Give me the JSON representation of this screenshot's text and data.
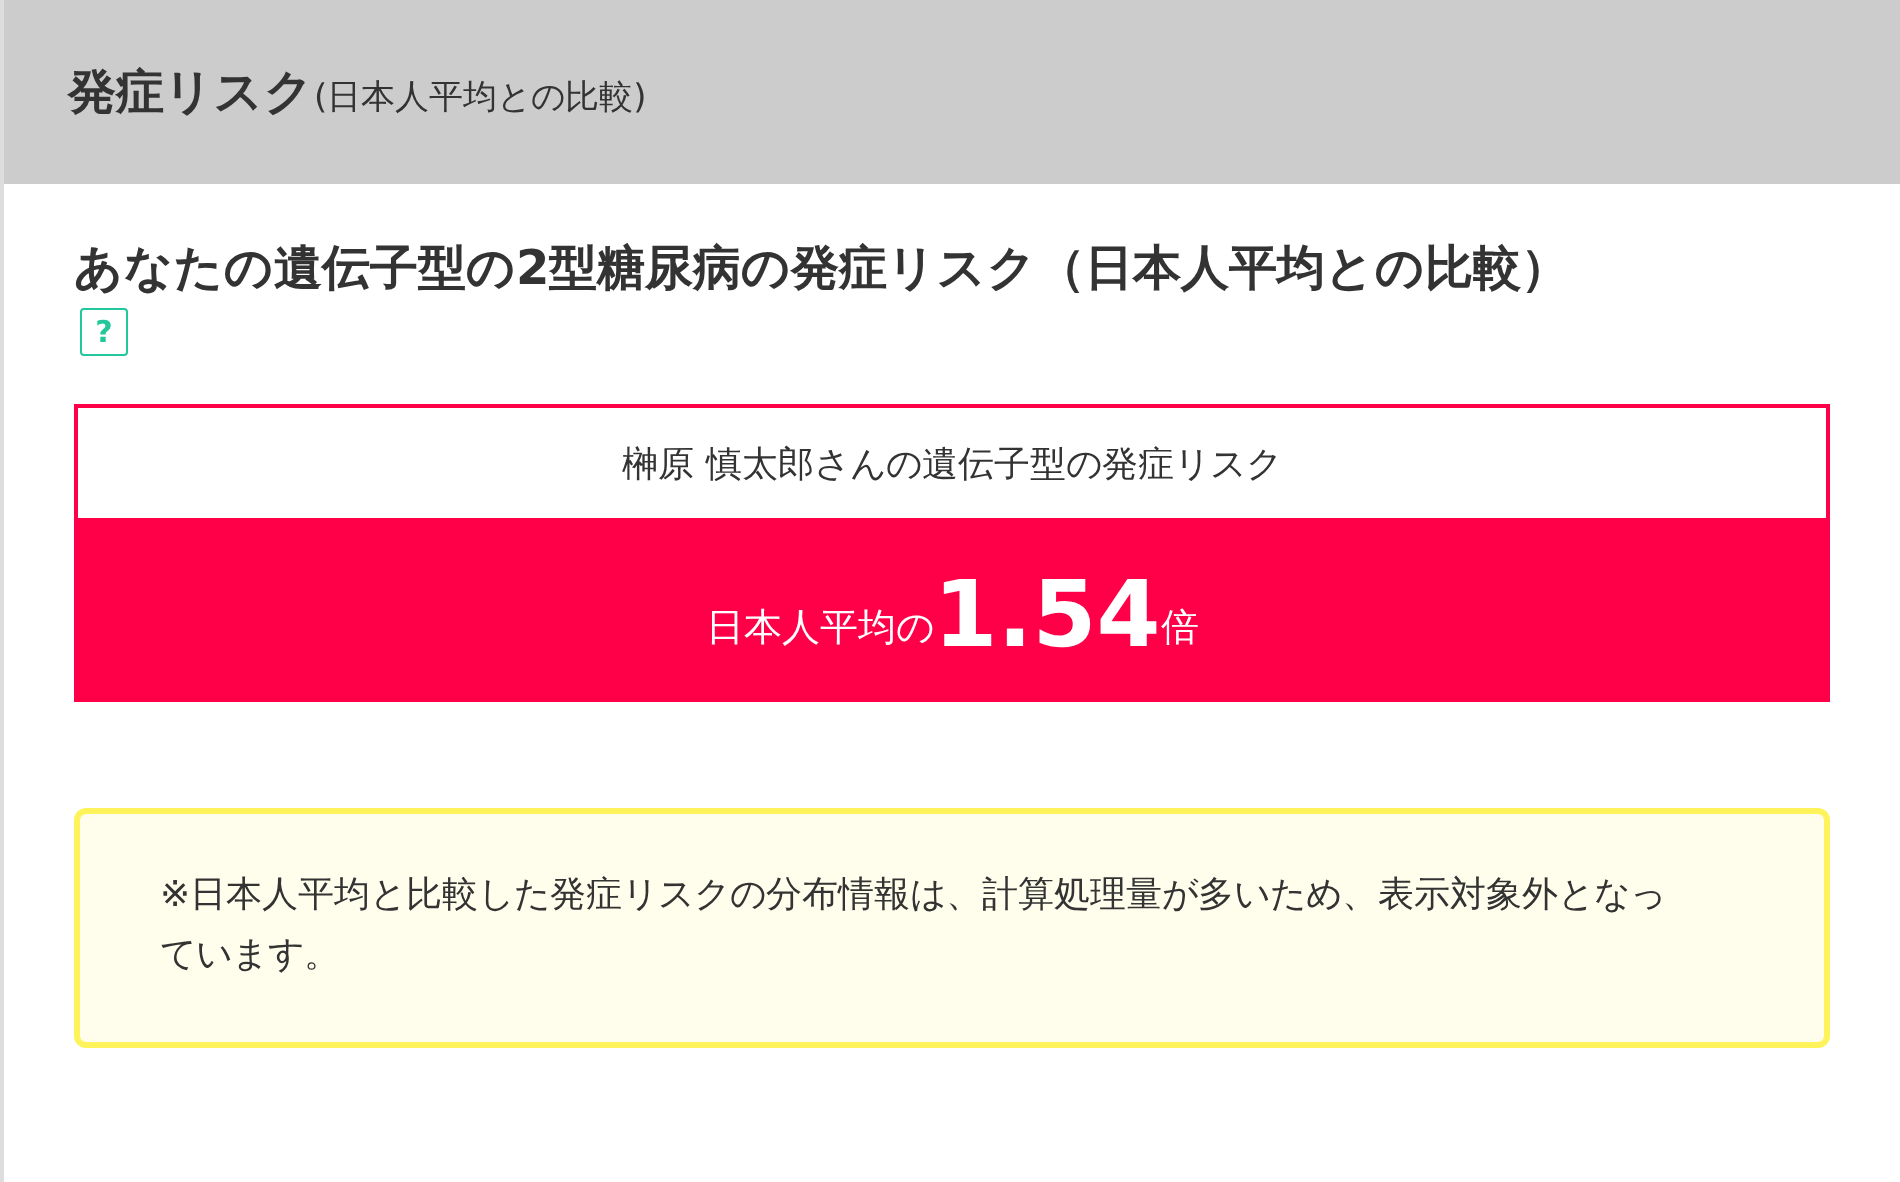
{
  "header": {
    "title": "発症リスク",
    "subtitle": "(日本人平均との比較)"
  },
  "section": {
    "title": "あなたの遺伝子型の2型糖尿病の発症リスク（日本人平均との比較）",
    "help": "?"
  },
  "risk": {
    "caption": "榊原 慎太郎さんの遺伝子型の発症リスク",
    "prefix": "日本人平均の",
    "value": "1.54",
    "suffix": "倍"
  },
  "note": "※日本人平均と比較した発症リスクの分布情報は、計算処理量が多いため、表示対象外となっています。"
}
